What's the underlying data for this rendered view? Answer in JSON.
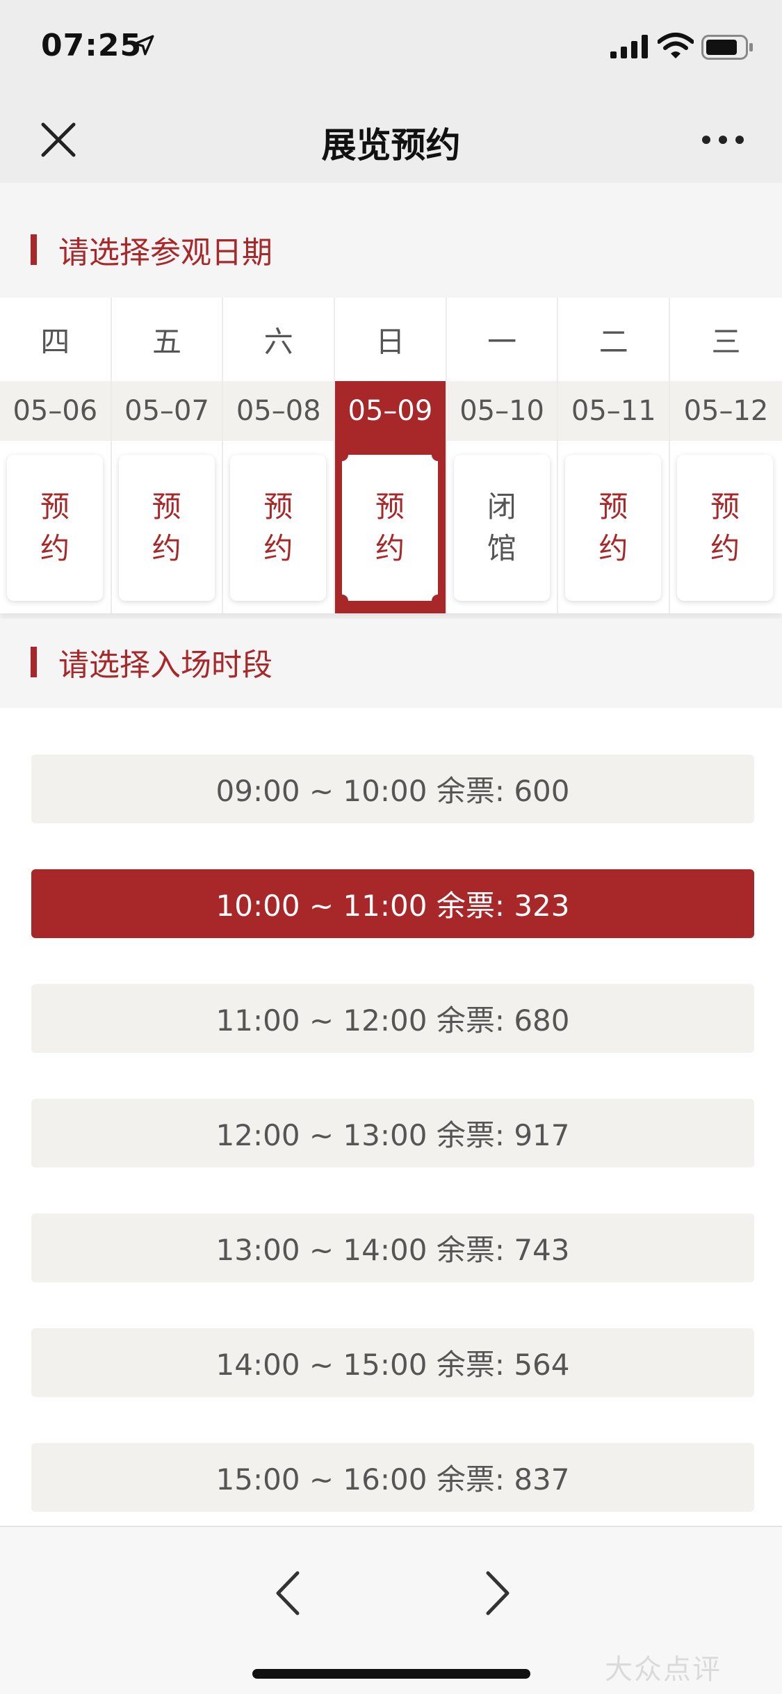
{
  "status_bar": {
    "time": "07:25"
  },
  "nav": {
    "title": "展览预约"
  },
  "date_section": {
    "title": "请选择参观日期"
  },
  "dates": [
    {
      "weekday": "四",
      "day": "05–06",
      "status": [
        "预",
        "约"
      ],
      "selected": false,
      "closed": false
    },
    {
      "weekday": "五",
      "day": "05–07",
      "status": [
        "预",
        "约"
      ],
      "selected": false,
      "closed": false
    },
    {
      "weekday": "六",
      "day": "05–08",
      "status": [
        "预",
        "约"
      ],
      "selected": false,
      "closed": false
    },
    {
      "weekday": "日",
      "day": "05–09",
      "status": [
        "预",
        "约"
      ],
      "selected": true,
      "closed": false
    },
    {
      "weekday": "一",
      "day": "05–10",
      "status": [
        "闭",
        "馆"
      ],
      "selected": false,
      "closed": true
    },
    {
      "weekday": "二",
      "day": "05–11",
      "status": [
        "预",
        "约"
      ],
      "selected": false,
      "closed": false
    },
    {
      "weekday": "三",
      "day": "05–12",
      "status": [
        "预",
        "约"
      ],
      "selected": false,
      "closed": false
    }
  ],
  "time_section": {
    "title": "请选择入场时段"
  },
  "time_slots": [
    {
      "label": "09:00 ~ 10:00 余票: 600",
      "selected": false
    },
    {
      "label": "10:00 ~ 11:00 余票: 323",
      "selected": true
    },
    {
      "label": "11:00 ~ 12:00 余票: 680",
      "selected": false
    },
    {
      "label": "12:00 ~ 13:00 余票: 917",
      "selected": false
    },
    {
      "label": "13:00 ~ 14:00 余票: 743",
      "selected": false
    },
    {
      "label": "14:00 ~ 15:00 余票: 564",
      "selected": false
    },
    {
      "label": "15:00 ~ 16:00 余票: 837",
      "selected": false
    }
  ],
  "watermark": "大众点评",
  "icons": {
    "close": "close-icon",
    "more": "more-icon",
    "back": "chevron-left-icon",
    "forward": "chevron-right-icon"
  },
  "colors": {
    "accent": "#a8282a",
    "slot_bg": "#f3f1ed"
  }
}
